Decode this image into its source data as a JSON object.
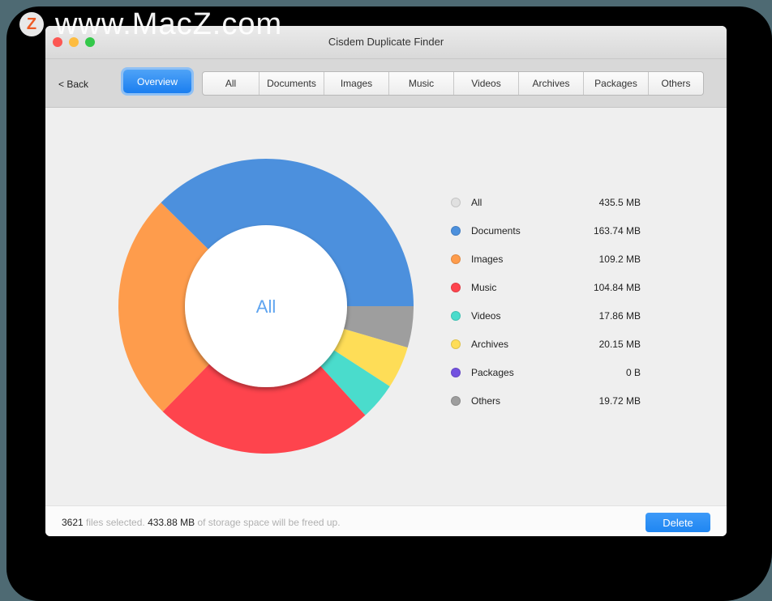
{
  "watermark": {
    "logo": "Z",
    "text": "www.MacZ.com"
  },
  "window": {
    "title": "Cisdem Duplicate Finder",
    "traffic_lights": {
      "close": "#fc5753",
      "minimize": "#fdbc40",
      "zoom": "#34c84a"
    }
  },
  "toolbar": {
    "back_label": "< Back",
    "overview_label": "Overview",
    "tabs": [
      {
        "label": "All"
      },
      {
        "label": "Documents"
      },
      {
        "label": "Images"
      },
      {
        "label": "Music"
      },
      {
        "label": "Videos"
      },
      {
        "label": "Archives"
      },
      {
        "label": "Packages"
      },
      {
        "label": "Others"
      }
    ]
  },
  "chart_data": {
    "type": "pie",
    "variant": "donut",
    "center_label": "All",
    "start": "east, clockwise",
    "slices": [
      {
        "name": "Others",
        "value": 19.72,
        "color": "#9e9e9e"
      },
      {
        "name": "Archives",
        "value": 20.15,
        "color": "#fedd57"
      },
      {
        "name": "Videos",
        "value": 17.86,
        "color": "#4adccc"
      },
      {
        "name": "Music",
        "value": 104.84,
        "color": "#fe444d"
      },
      {
        "name": "Images",
        "value": 109.2,
        "color": "#fe9c4c"
      },
      {
        "name": "Documents",
        "value": 163.74,
        "color": "#4c90dd"
      }
    ],
    "unit": "MB"
  },
  "legend": [
    {
      "label": "All",
      "value": "435.5 MB",
      "color": "#e0e0e0"
    },
    {
      "label": "Documents",
      "value": "163.74 MB",
      "color": "#4c90dd"
    },
    {
      "label": "Images",
      "value": "109.2 MB",
      "color": "#fe9c4c"
    },
    {
      "label": "Music",
      "value": "104.84 MB",
      "color": "#fe444d"
    },
    {
      "label": "Videos",
      "value": "17.86 MB",
      "color": "#4adccc"
    },
    {
      "label": "Archives",
      "value": "20.15 MB",
      "color": "#fedd57"
    },
    {
      "label": "Packages",
      "value": "0 B",
      "color": "#7352e0"
    },
    {
      "label": "Others",
      "value": "19.72 MB",
      "color": "#9e9e9e"
    }
  ],
  "footer": {
    "file_count": "3621",
    "files_text": " files selected. ",
    "size": "433.88 MB",
    "size_text": " of storage space will be freed up.",
    "delete_label": "Delete"
  }
}
